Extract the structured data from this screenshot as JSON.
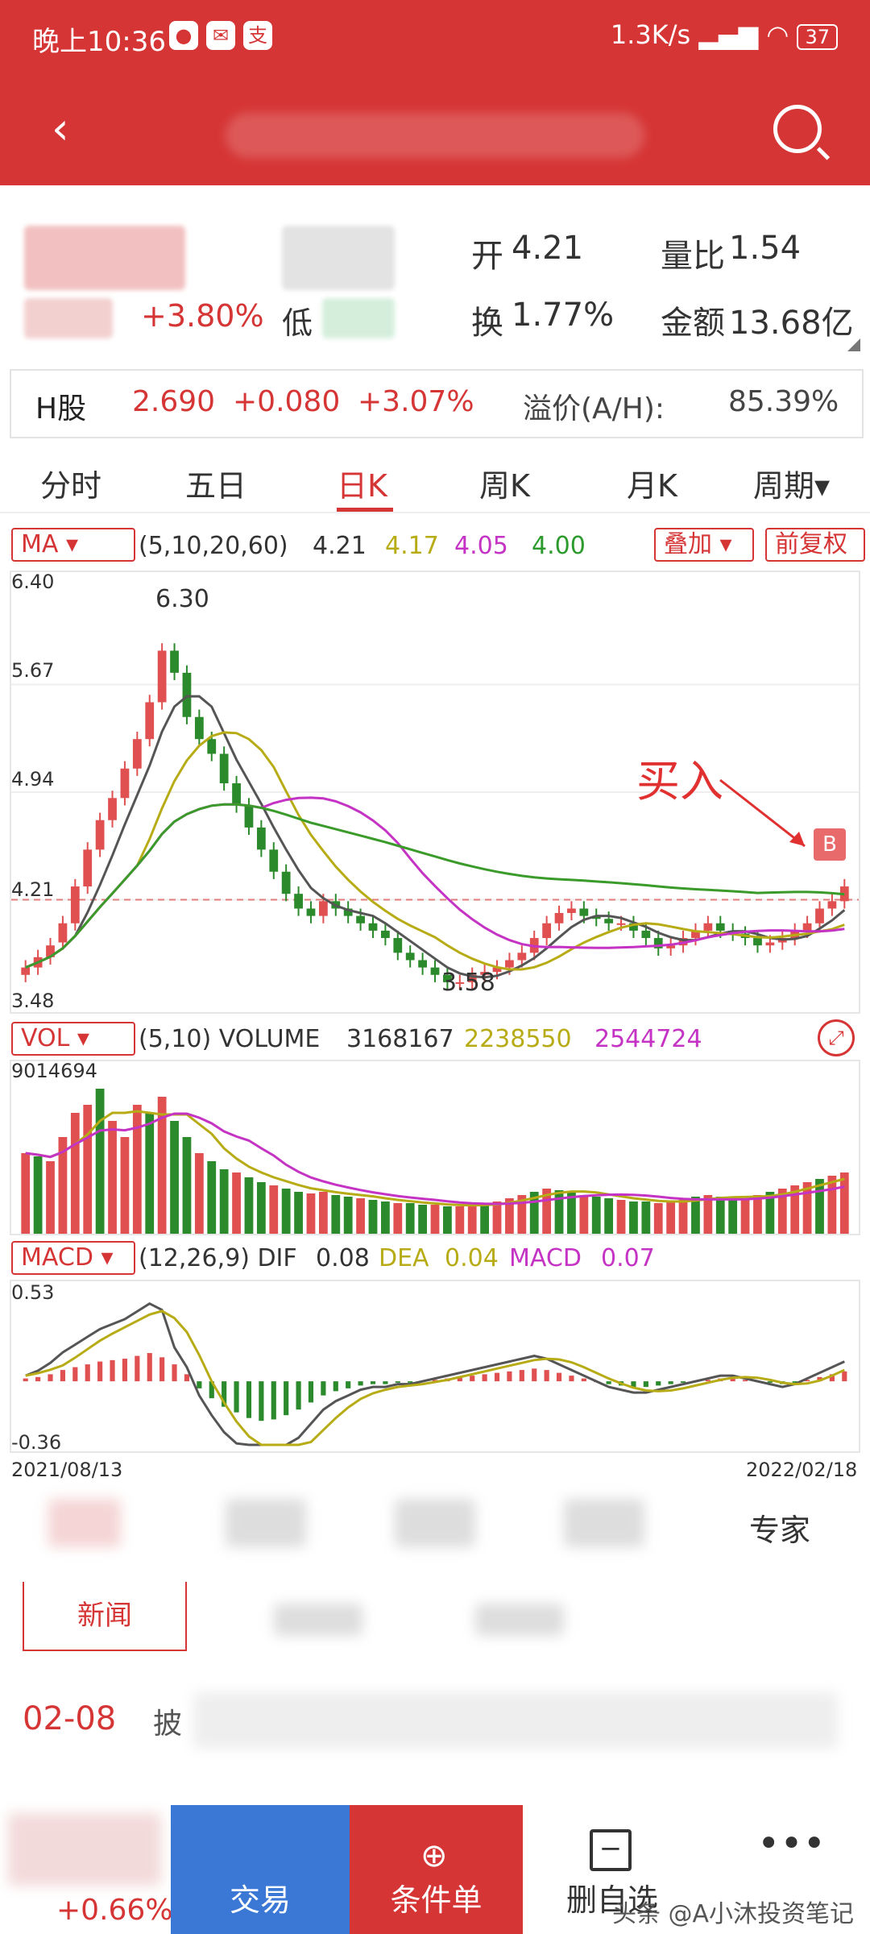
{
  "status_bar": {
    "time": "晚上10:36",
    "icons": [
      "qq-icon",
      "chat-app-icon",
      "alipay-icon"
    ],
    "network_speed": "1.3K/s",
    "battery": "37"
  },
  "header": {
    "back_icon": "back-arrow-icon",
    "search_icon": "search-icon"
  },
  "quote": {
    "change_pct": "+3.80%",
    "low_label": "低",
    "open_label": "开",
    "open_value": "4.21",
    "vol_ratio_label": "量比",
    "vol_ratio_value": "1.54",
    "turnover_label": "换",
    "turnover_value": "1.77%",
    "amount_label": "金额",
    "amount_value": "13.68亿"
  },
  "h_share": {
    "label": "H股",
    "price": "2.690",
    "change": "+0.080",
    "change_pct": "+3.07%",
    "premium_label": "溢价(A/H):",
    "premium_value": "85.39%"
  },
  "tabs": [
    {
      "label": "分时"
    },
    {
      "label": "五日"
    },
    {
      "label": "日K"
    },
    {
      "label": "周K"
    },
    {
      "label": "月K"
    },
    {
      "label": "周期▾"
    }
  ],
  "ma_bar": {
    "selector": "MA",
    "params": "(5,10,20,60)",
    "v1": "4.21",
    "v2": "4.17",
    "v3": "4.05",
    "v4": "4.00",
    "overlay": "叠加",
    "adjust": "前复权"
  },
  "vol_bar": {
    "selector": "VOL",
    "params": "(5,10) VOLUME",
    "v1": "3168167",
    "v2": "2238550",
    "v3": "2544724"
  },
  "macd_bar": {
    "selector": "MACD",
    "params": "(12,26,9) DIF",
    "dif": "0.08",
    "dea_label": "DEA",
    "dea": "0.04",
    "macd_label": "MACD",
    "macd": "0.07"
  },
  "colors": {
    "accent": "#d63535",
    "up": "#e05050",
    "down": "#2b8a2b",
    "ma5": "#555555",
    "ma10": "#b7ab16",
    "ma20": "#c433c4",
    "ma60": "#3a9a2a",
    "trade": "#3b78d6"
  },
  "chart_data": [
    {
      "type": "candlestick",
      "ylim": [
        3.48,
        6.4
      ],
      "y_ticks": [
        "6.40",
        "5.67",
        "4.94",
        "4.21",
        "3.48"
      ],
      "high_label": "6.30",
      "low_label": "3.58",
      "annotation": "买入",
      "buy_marker": "B",
      "date_start": "2021/08/13",
      "date_end": "2022/02/18",
      "closes": [
        3.75,
        3.82,
        3.9,
        4.05,
        4.3,
        4.55,
        4.75,
        4.9,
        5.1,
        5.3,
        5.55,
        5.9,
        5.75,
        5.45,
        5.3,
        5.2,
        5.0,
        4.85,
        4.7,
        4.55,
        4.4,
        4.25,
        4.15,
        4.1,
        4.2,
        4.15,
        4.1,
        4.05,
        4.0,
        3.95,
        3.85,
        3.8,
        3.75,
        3.7,
        3.65,
        3.65,
        3.7,
        3.72,
        3.75,
        3.8,
        3.85,
        3.95,
        4.05,
        4.12,
        4.15,
        4.1,
        4.08,
        4.05,
        4.05,
        4.0,
        3.95,
        3.88,
        3.9,
        3.95,
        4.0,
        4.05,
        4.0,
        3.98,
        3.95,
        3.9,
        3.92,
        3.95,
        4.0,
        4.05,
        4.15,
        4.2,
        4.3
      ],
      "opens": [
        3.7,
        3.75,
        3.82,
        3.92,
        4.05,
        4.3,
        4.55,
        4.75,
        4.9,
        5.1,
        5.3,
        5.55,
        5.9,
        5.75,
        5.45,
        5.3,
        5.2,
        5.0,
        4.85,
        4.7,
        4.55,
        4.4,
        4.25,
        4.15,
        4.1,
        4.2,
        4.15,
        4.1,
        4.05,
        4.0,
        3.95,
        3.85,
        3.8,
        3.75,
        3.7,
        3.65,
        3.65,
        3.7,
        3.72,
        3.75,
        3.8,
        3.85,
        3.95,
        4.05,
        4.12,
        4.15,
        4.1,
        4.08,
        4.05,
        4.05,
        4.0,
        3.95,
        3.88,
        3.9,
        3.95,
        4.0,
        4.05,
        4.0,
        3.98,
        3.95,
        3.9,
        3.92,
        3.95,
        4.0,
        4.05,
        4.15,
        4.2
      ]
    },
    {
      "type": "bar",
      "max_label": "9014694",
      "values": [
        5,
        4.8,
        4.5,
        6,
        7.5,
        8,
        9,
        7,
        6,
        8,
        7.5,
        8.5,
        7,
        6,
        5,
        4.5,
        4,
        3.8,
        3.5,
        3.2,
        3,
        2.8,
        2.6,
        2.5,
        2.6,
        2.4,
        2.3,
        2.2,
        2.1,
        2.0,
        1.9,
        1.9,
        1.8,
        1.8,
        1.7,
        1.7,
        1.8,
        1.9,
        2.0,
        2.2,
        2.4,
        2.6,
        2.8,
        2.7,
        2.6,
        2.4,
        2.3,
        2.2,
        2.1,
        2.0,
        2.0,
        1.9,
        2.0,
        2.1,
        2.3,
        2.4,
        2.3,
        2.2,
        2.2,
        2.4,
        2.6,
        2.8,
        3.0,
        3.2,
        3.4,
        3.6,
        3.8
      ],
      "up_flags": [
        1,
        0,
        1,
        1,
        1,
        1,
        0,
        1,
        1,
        1,
        0,
        1,
        0,
        0,
        1,
        0,
        0,
        1,
        0,
        0,
        1,
        0,
        0,
        1,
        1,
        0,
        0,
        1,
        0,
        0,
        1,
        0,
        0,
        1,
        0,
        1,
        1,
        0,
        1,
        1,
        1,
        0,
        1,
        0,
        0,
        1,
        0,
        0,
        1,
        0,
        0,
        1,
        1,
        1,
        0,
        1,
        0,
        0,
        1,
        1,
        0,
        1,
        1,
        1,
        0,
        1,
        1
      ]
    },
    {
      "type": "bar",
      "ylim": [
        -0.36,
        0.53
      ],
      "y_ticks": [
        "0.53",
        "-0.36"
      ],
      "values": [
        0.02,
        0.03,
        0.05,
        0.08,
        0.1,
        0.12,
        0.14,
        0.15,
        0.16,
        0.18,
        0.2,
        0.17,
        0.12,
        0.05,
        -0.05,
        -0.12,
        -0.18,
        -0.22,
        -0.26,
        -0.28,
        -0.27,
        -0.24,
        -0.2,
        -0.15,
        -0.1,
        -0.07,
        -0.05,
        -0.03,
        -0.02,
        -0.02,
        -0.01,
        -0.01,
        0.0,
        0.01,
        0.02,
        0.03,
        0.04,
        0.05,
        0.06,
        0.07,
        0.08,
        0.09,
        0.08,
        0.06,
        0.04,
        0.02,
        0.0,
        -0.02,
        -0.03,
        -0.04,
        -0.04,
        -0.03,
        -0.02,
        -0.01,
        0.0,
        0.01,
        0.02,
        0.02,
        0.01,
        0.0,
        -0.01,
        -0.02,
        -0.01,
        0.01,
        0.03,
        0.05,
        0.07
      ]
    }
  ],
  "lower": {
    "expert_tab": "专家",
    "news_tab": "新闻",
    "news_date": "02-08",
    "news_lead": "披"
  },
  "bottom_bar": {
    "index_change": "+0.66%",
    "trade": "交易",
    "conditional": "条件单",
    "remove_watch": "删自选",
    "watermark": "头条 @A小沐投资笔记"
  }
}
